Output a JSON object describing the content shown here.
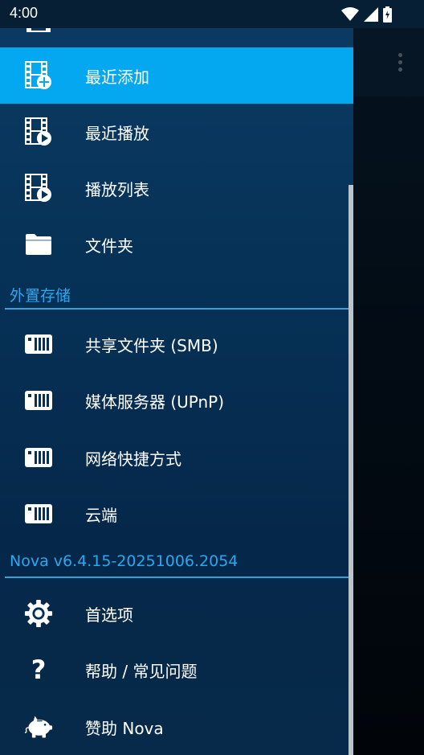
{
  "status_bar": {
    "time": "4:00"
  },
  "drawer": {
    "items_top": [
      {
        "label": "最近添加",
        "icon": "video-add-icon",
        "active": true
      },
      {
        "label": "最近播放",
        "icon": "video-play-icon",
        "active": false
      },
      {
        "label": "播放列表",
        "icon": "playlist-icon",
        "active": false
      },
      {
        "label": "文件夹",
        "icon": "folder-icon",
        "active": false
      }
    ],
    "section_storage": "外置存储",
    "items_storage": [
      {
        "label": "共享文件夹 (SMB)",
        "icon": "network-drive-icon"
      },
      {
        "label": "媒体服务器 (UPnP)",
        "icon": "network-drive-icon"
      },
      {
        "label": "网络快捷方式",
        "icon": "network-drive-icon"
      },
      {
        "label": "云端",
        "icon": "network-drive-icon"
      }
    ],
    "section_version": "Nova v6.4.15-20251006.2054",
    "items_bottom": [
      {
        "label": "首选项",
        "icon": "gear-icon"
      },
      {
        "label": "帮助 / 常见问题",
        "icon": "question-icon"
      },
      {
        "label": "赞助 Nova",
        "icon": "piggy-bank-icon"
      }
    ]
  },
  "colors": {
    "accent": "#03a8f0",
    "section_text": "#2aa8ef",
    "drawer_bg": "#063055"
  }
}
